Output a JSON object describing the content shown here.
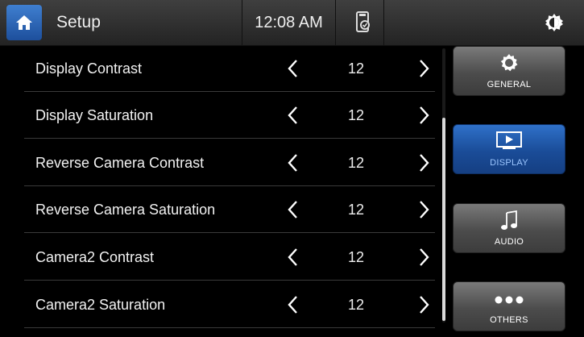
{
  "header": {
    "title": "Setup",
    "time": "12:08 AM",
    "home_icon": "home-icon",
    "phone_icon": "phone-link-icon",
    "brightness_icon": "brightness-icon",
    "accent_color": "#2a66bf"
  },
  "settings": [
    {
      "label": "Display Contrast",
      "value": "12"
    },
    {
      "label": "Display Saturation",
      "value": "12"
    },
    {
      "label": "Reverse Camera Contrast",
      "value": "12"
    },
    {
      "label": "Reverse Camera Saturation",
      "value": "12"
    },
    {
      "label": "Camera2 Contrast",
      "value": "12"
    },
    {
      "label": "Camera2 Saturation",
      "value": "12"
    }
  ],
  "nav": [
    {
      "label": "GENERAL",
      "icon": "gear-icon",
      "active": false
    },
    {
      "label": "DISPLAY",
      "icon": "display-icon",
      "active": true
    },
    {
      "label": "AUDIO",
      "icon": "music-note-icon",
      "active": false
    },
    {
      "label": "OTHERS",
      "icon": "more-dots-icon",
      "active": false
    }
  ]
}
